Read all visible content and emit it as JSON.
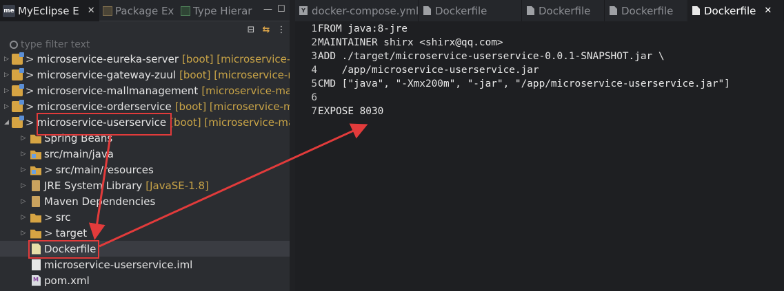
{
  "left_panel": {
    "tabs": [
      {
        "logo": "me",
        "label": "MyEclipse E",
        "close": "✕",
        "icon": "myeclipse-logo"
      },
      {
        "label": "Package Ex",
        "icon": "package-icon"
      },
      {
        "label": "Type Hierar",
        "icon": "hierarchy-icon"
      }
    ],
    "minimize": "—",
    "maximize": "☐",
    "toolbar": {
      "collapse": "⊟",
      "sync": "⇆",
      "menu": "⋮"
    },
    "filter_placeholder": "type filter text",
    "tree": [
      {
        "twisty": "▷",
        "prefix": ">",
        "name": "microservice-eureka-server",
        "extra": "[boot] [microservice-",
        "icon": "project"
      },
      {
        "twisty": "▷",
        "prefix": ">",
        "name": "microservice-gateway-zuul",
        "extra": "[boot] [microservice-r",
        "icon": "project"
      },
      {
        "twisty": "▷",
        "prefix": ">",
        "name": "microservice-mallmanagement",
        "extra": "[microservice-mal",
        "icon": "project"
      },
      {
        "twisty": "▷",
        "prefix": ">",
        "name": "microservice-orderservice",
        "extra": "[boot] [microservice-m",
        "icon": "project"
      },
      {
        "twisty": "◢",
        "prefix": ">",
        "name": "microservice-userservice",
        "extra": "[boot] [microservice-ma",
        "icon": "project"
      },
      {
        "twisty": "▷",
        "prefix": "",
        "name": "Spring Beans",
        "extra": "",
        "icon": "folder"
      },
      {
        "twisty": "▷",
        "prefix": "",
        "name": "src/main/java",
        "extra": "",
        "icon": "srcfolder"
      },
      {
        "twisty": "▷",
        "prefix": ">",
        "name": "src/main/resources",
        "extra": "",
        "icon": "srcfolder"
      },
      {
        "twisty": "▷",
        "prefix": "",
        "name": "JRE System Library",
        "extra": "[JavaSE-1.8]",
        "icon": "library"
      },
      {
        "twisty": "▷",
        "prefix": "",
        "name": "Maven Dependencies",
        "extra": "",
        "icon": "library"
      },
      {
        "twisty": "▷",
        "prefix": ">",
        "name": "src",
        "extra": "",
        "icon": "folder"
      },
      {
        "twisty": "▷",
        "prefix": ">",
        "name": "target",
        "extra": "",
        "icon": "folder"
      },
      {
        "twisty": "",
        "prefix": "",
        "name": "Dockerfile",
        "extra": "",
        "icon": "file",
        "selected": true
      },
      {
        "twisty": "",
        "prefix": "",
        "name": "microservice-userservice.iml",
        "extra": "",
        "icon": "iml"
      },
      {
        "twisty": "",
        "prefix": "",
        "name": "pom.xml",
        "extra": "",
        "icon": "xml"
      }
    ]
  },
  "editor": {
    "tabs": [
      {
        "label": "docker-compose.yml",
        "icon": "yaml",
        "active": false
      },
      {
        "label": "Dockerfile",
        "icon": "doc",
        "active": false
      },
      {
        "label": "Dockerfile",
        "icon": "doc",
        "active": false
      },
      {
        "label": "Dockerfile",
        "icon": "doc",
        "active": false
      },
      {
        "label": "Dockerfile",
        "icon": "doc",
        "active": true
      }
    ],
    "close": "✕",
    "lines": [
      {
        "n": "1",
        "text": "FROM java:8-jre"
      },
      {
        "n": "2",
        "text": "MAINTAINER shirx <shirx@qq.com>"
      },
      {
        "n": "3",
        "text": "ADD ./target/microservice-userservice-0.0.1-SNAPSHOT.jar \\"
      },
      {
        "n": "4",
        "text": "    /app/microservice-userservice.jar"
      },
      {
        "n": "5",
        "text": "CMD [\"java\", \"-Xmx200m\", \"-jar\", \"/app/microservice-userservice.jar\"]"
      },
      {
        "n": "6",
        "text": ""
      },
      {
        "n": "7",
        "text": "EXPOSE 8030"
      }
    ]
  },
  "colors": {
    "annotation": "#e23b3b",
    "decorator": "#c9a447"
  }
}
